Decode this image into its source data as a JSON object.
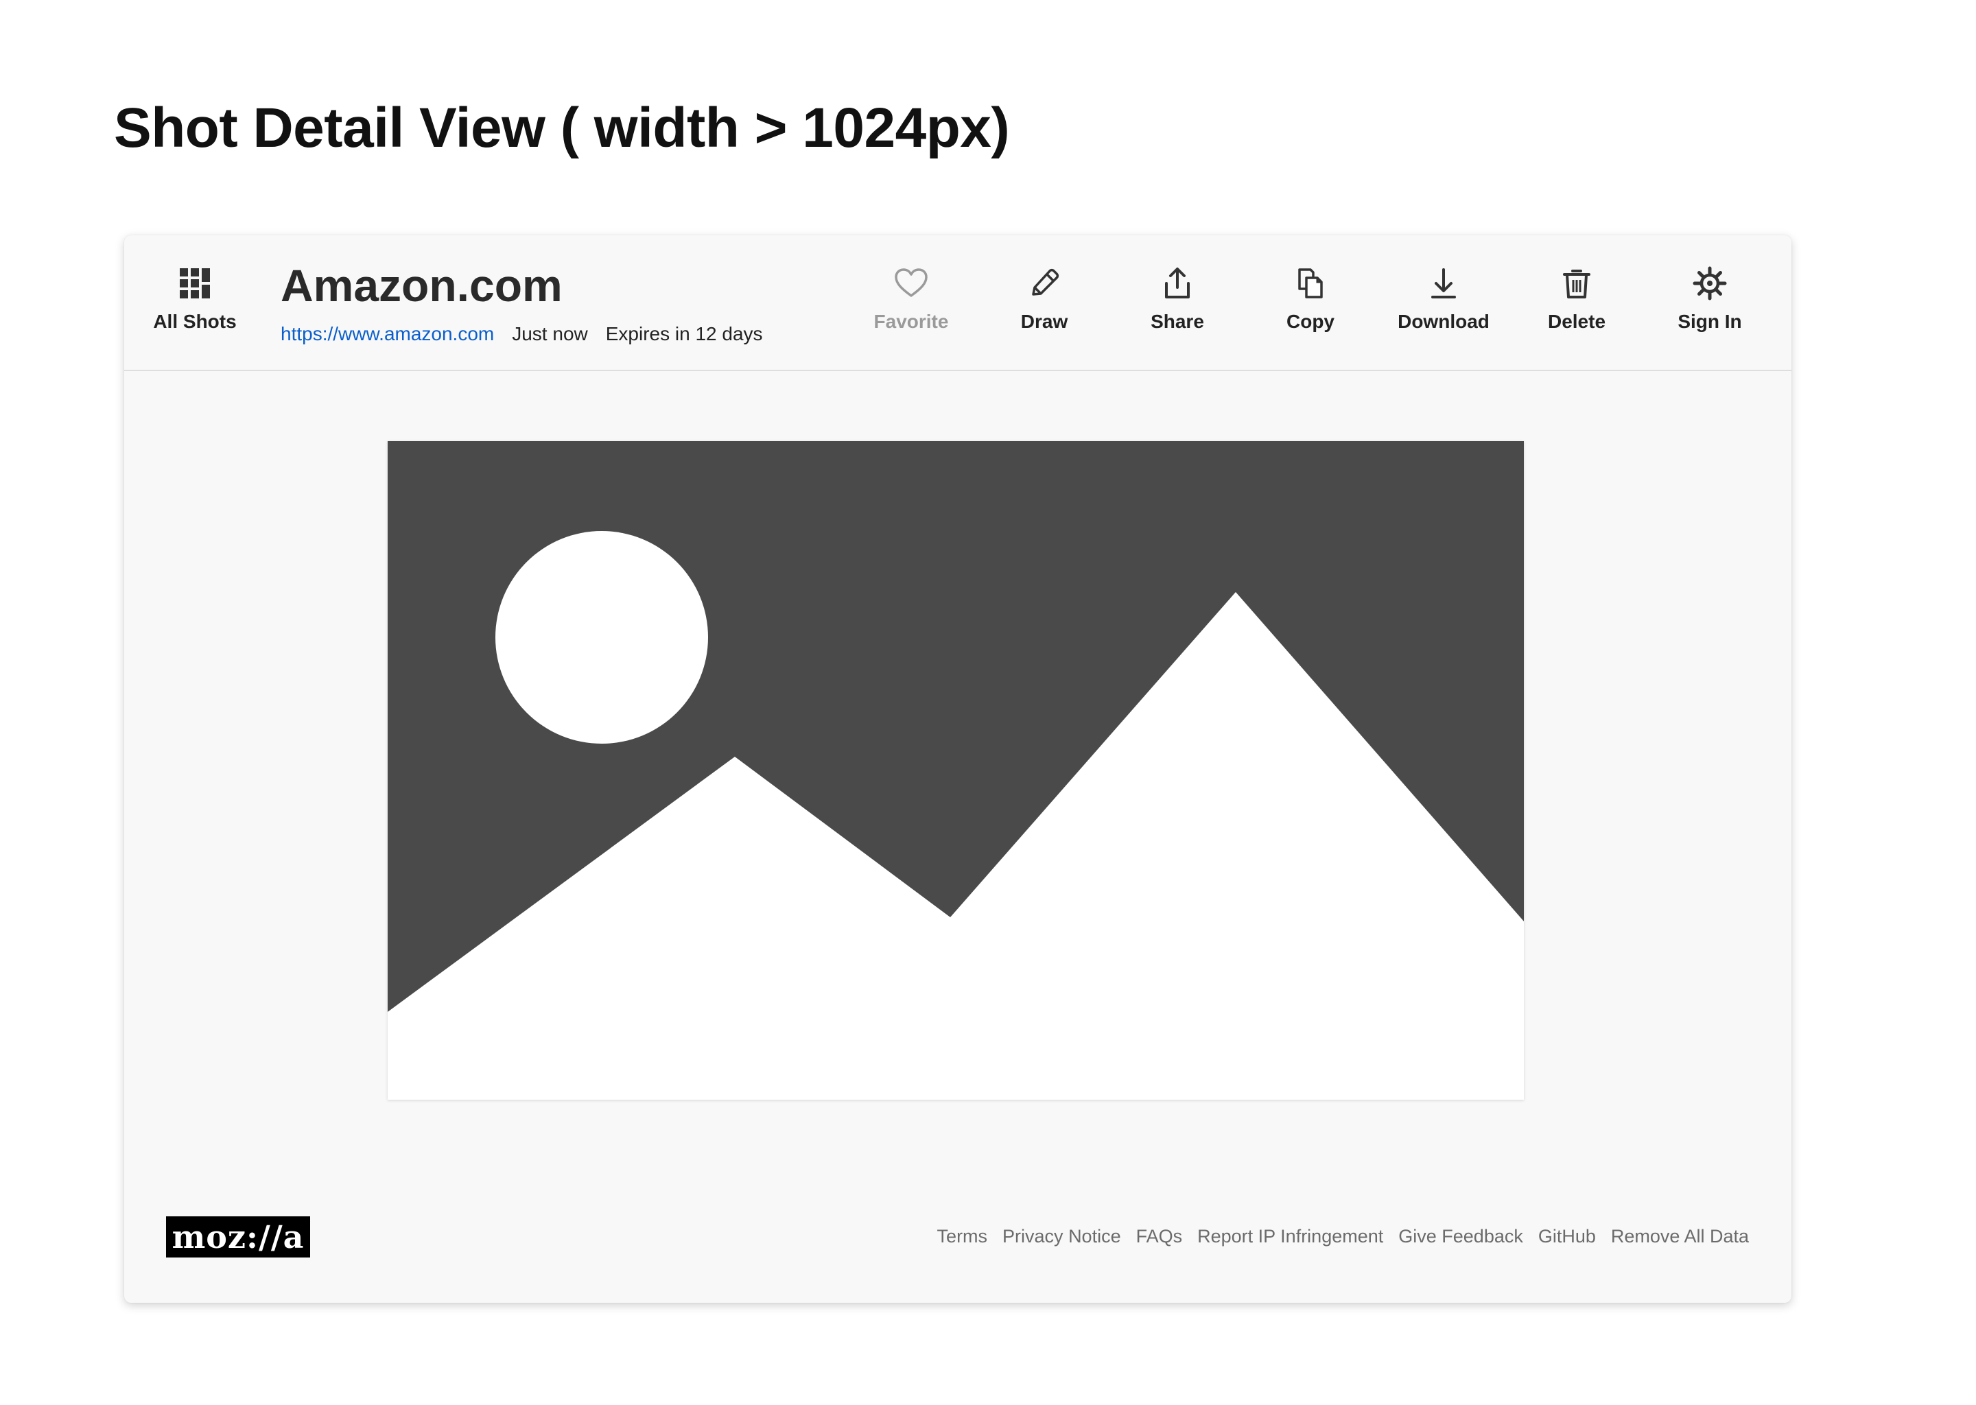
{
  "page_title": "Shot Detail View ( width > 1024px)",
  "header": {
    "all_shots_label": "All Shots",
    "shot_title": "Amazon.com",
    "shot_url": "https://www.amazon.com",
    "shot_time": "Just now",
    "shot_expires": "Expires in 12 days",
    "actions": [
      {
        "label": "Favorite",
        "icon": "heart-icon",
        "disabled": true
      },
      {
        "label": "Draw",
        "icon": "pencil-icon"
      },
      {
        "label": "Share",
        "icon": "share-icon"
      },
      {
        "label": "Copy",
        "icon": "copy-icon"
      },
      {
        "label": "Download",
        "icon": "download-icon"
      },
      {
        "label": "Delete",
        "icon": "trash-icon"
      },
      {
        "label": "Sign In",
        "icon": "gear-icon"
      }
    ]
  },
  "screenshot": {
    "placeholder_icon": "image-placeholder-icon",
    "colors": {
      "background": "#4a4a4a",
      "shapes": "#ffffff"
    }
  },
  "footer": {
    "logo_text": "moz://a",
    "links": [
      "Terms",
      "Privacy Notice",
      "FAQs",
      "Report IP Infringement",
      "Give Feedback",
      "GitHub",
      "Remove All Data"
    ]
  },
  "colors": {
    "link": "#0a5fcc",
    "text": "#222222",
    "muted": "#9a9a9a",
    "frame_bg": "#f8f8f8"
  }
}
